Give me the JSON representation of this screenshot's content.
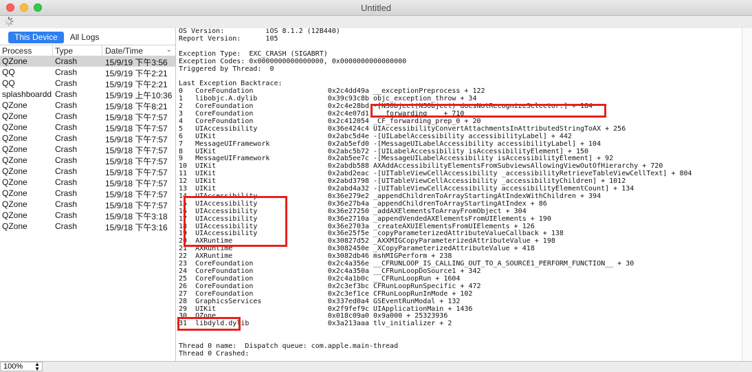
{
  "window": {
    "title": "Untitled"
  },
  "sidebar": {
    "tabs": [
      "This Device",
      "All Logs"
    ],
    "columns": {
      "process": "Process",
      "type": "Type",
      "date": "Date/Time"
    },
    "rows": [
      {
        "process": "QZone",
        "type": "Crash",
        "date": "15/9/19 下午3:56"
      },
      {
        "process": "QQ",
        "type": "Crash",
        "date": "15/9/19 下午2:21"
      },
      {
        "process": "QQ",
        "type": "Crash",
        "date": "15/9/19 下午2:21"
      },
      {
        "process": "splashboardd",
        "type": "Crash",
        "date": "15/9/19 上午10:36"
      },
      {
        "process": "QZone",
        "type": "Crash",
        "date": "15/9/18 下午8:21"
      },
      {
        "process": "QZone",
        "type": "Crash",
        "date": "15/9/18 下午7:57"
      },
      {
        "process": "QZone",
        "type": "Crash",
        "date": "15/9/18 下午7:57"
      },
      {
        "process": "QZone",
        "type": "Crash",
        "date": "15/9/18 下午7:57"
      },
      {
        "process": "QZone",
        "type": "Crash",
        "date": "15/9/18 下午7:57"
      },
      {
        "process": "QZone",
        "type": "Crash",
        "date": "15/9/18 下午7:57"
      },
      {
        "process": "QZone",
        "type": "Crash",
        "date": "15/9/18 下午7:57"
      },
      {
        "process": "QZone",
        "type": "Crash",
        "date": "15/9/18 下午7:57"
      },
      {
        "process": "QZone",
        "type": "Crash",
        "date": "15/9/18 下午7:57"
      },
      {
        "process": "QZone",
        "type": "Crash",
        "date": "15/9/18 下午7:57"
      },
      {
        "process": "QZone",
        "type": "Crash",
        "date": "15/9/18 下午3:18"
      },
      {
        "process": "QZone",
        "type": "Crash",
        "date": "15/9/18 下午3:16"
      }
    ]
  },
  "log": {
    "text": "OS Version:          iOS 8.1.2 (12B440)\nReport Version:      105\n\nException Type:  EXC_CRASH (SIGABRT)\nException Codes: 0x0000000000000000, 0x0000000000000000\nTriggered by Thread:  0\n\nLast Exception Backtrace:\n0   CoreFoundation                  0x2c4dd49a __exceptionPreprocess + 122\n1   libobjc.A.dylib                 0x39c93c8b objc_exception_throw + 34\n2   CoreFoundation                  0x2c4e28bd -[NSObject(NSObject) doesNotRecognizeSelector:] + 184\n3   CoreFoundation                  0x2c4e07d1 ___forwarding___ + 710\n4   CoreFoundation                  0x2c412054 _CF_forwarding_prep_0 + 20\n5   UIAccessibility                 0x36e424c4 UIAccessibilityConvertAttachmentsInAttributedStringToAX + 256\n6   UIKit                           0x2abc5d4e -[UILabelAccessibility accessibilityLabel] + 442\n7   MessageUIFramework              0x2ab5efd0 -[MessageUILabelAccessibility accessibilityLabel] + 104\n8   UIKit                           0x2abc5b72 -[UILabelAccessibility isAccessibilityElement] + 150\n9   MessageUIFramework              0x2ab5ee7c -[MessageUILabelAccessibility isAccessibilityElement] + 92\n10  UIKit                           0x2abdb588 AXAddAccessibilityElementsFromSubviewsAllowingViewOutOfHierarchy + 720\n11  UIKit                           0x2abd2eac -[UITableViewCellAccessibility _accessibilityRetrieveTableViewCellText] + 804\n12  UIKit                           0x2abd3798 -[UITableViewCellAccessibility _accessibilityChildren] + 1012\n13  UIKit                           0x2abd4a32 -[UITableViewCellAccessibility accessibilityElementCount] + 134\n14  UIAccessibility                 0x36e279e2 _appendChildrenToArrayStartingAtIndexWithChildren + 394\n15  UIAccessibility                 0x36e27b4a _appendChildrenToArrayStartingAtIndex + 86\n16  UIAccessibility                 0x36e27250 _addAXElementsToArrayFromObject + 304\n17  UIAccessibility                 0x36e2710a _appendVendedAXElementsFromUIElements + 190\n18  UIAccessibility                 0x36e2703a _createAXUIElementsFromUIElements + 126\n19  UIAccessibility                 0x36e25f5e _copyParameterizedAttributeValueCallback + 138\n20  AXRuntime                       0x30827d52 _AXXMIGCopyParameterizedAttributeValue + 198\n21  AXRuntime                       0x3082450e _XCopyParameterizedAttributeValue + 418\n22  AXRuntime                       0x3082db46 mshMIGPerform + 238\n23  CoreFoundation                  0x2c4a356e __CFRUNLOOP_IS_CALLING_OUT_TO_A_SOURCE1_PERFORM_FUNCTION__ + 30\n24  CoreFoundation                  0x2c4a350a __CFRunLoopDoSource1 + 342\n25  CoreFoundation                  0x2c4a1b0c __CFRunLoopRun + 1604\n26  CoreFoundation                  0x2c3ef3bc CFRunLoopRunSpecific + 472\n27  CoreFoundation                  0x2c3ef1ce CFRunLoopRunInMode + 102\n28  GraphicsServices                0x337ed0a4 GSEventRunModal + 132\n29  UIKit                           0x2f9fef9c UIApplicationMain + 1436\n30  QZone                           0x018c09a0 0x9a000 + 25323936\n31  libdyld.dylib                   0x3a213aaa tlv_initializer + 2\n\n\nThread 0 name:  Dispatch queue: com.apple.main-thread\nThread 0 Crashed:"
  },
  "status": {
    "zoom": "100%"
  }
}
